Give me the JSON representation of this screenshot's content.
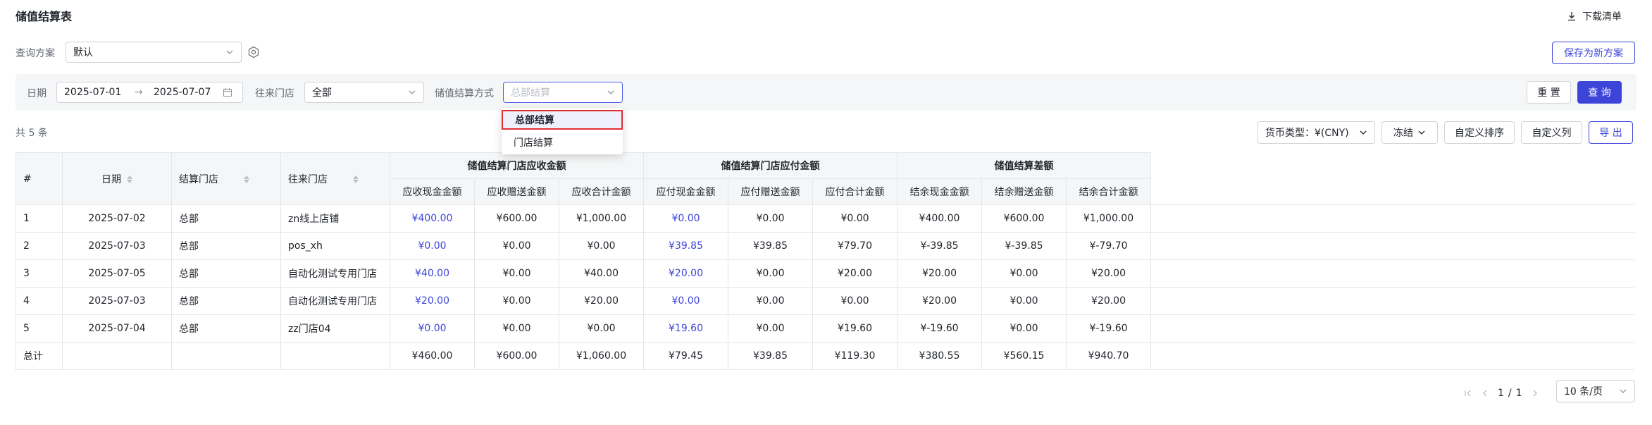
{
  "header": {
    "title": "储值结算表",
    "download_label": "下载清单"
  },
  "plan": {
    "label": "查询方案",
    "value": "默认",
    "save_label": "保存为新方案"
  },
  "filters": {
    "date_label": "日期",
    "date_start": "2025-07-01",
    "date_sep": "→",
    "date_end": "2025-07-07",
    "store_label": "往来门店",
    "store_value": "全部",
    "method_label": "储值结算方式",
    "method_placeholder": "总部结算",
    "reset_label": "重 置",
    "query_label": "查 询"
  },
  "dropdown": {
    "options": [
      "总部结算",
      "门店结算"
    ],
    "selected_index": 0
  },
  "toolbar": {
    "count": "共 5 条",
    "currency_label": "货币类型：¥(CNY)",
    "freeze_label": "冻结",
    "custom_sort_label": "自定义排序",
    "custom_cols_label": "自定义列",
    "export_label": "导 出"
  },
  "table": {
    "fixed_headers": [
      "#",
      "日期",
      "结算门店",
      "往来门店"
    ],
    "groups": [
      {
        "label": "储值结算门店应收金额",
        "cols": [
          "应收现金金额",
          "应收赠送金额",
          "应收合计金额"
        ]
      },
      {
        "label": "储值结算门店应付金额",
        "cols": [
          "应付现金金额",
          "应付赠送金额",
          "应付合计金额"
        ]
      },
      {
        "label": "储值结算差额",
        "cols": [
          "结余现金金额",
          "结余赠送金额",
          "结余合计金额"
        ]
      }
    ],
    "rows": [
      [
        "1",
        "2025-07-02",
        "总部",
        "zn线上店铺",
        "¥400.00",
        "¥600.00",
        "¥1,000.00",
        "¥0.00",
        "¥0.00",
        "¥0.00",
        "¥400.00",
        "¥600.00",
        "¥1,000.00"
      ],
      [
        "2",
        "2025-07-03",
        "总部",
        "pos_xh",
        "¥0.00",
        "¥0.00",
        "¥0.00",
        "¥39.85",
        "¥39.85",
        "¥79.70",
        "¥-39.85",
        "¥-39.85",
        "¥-79.70"
      ],
      [
        "3",
        "2025-07-05",
        "总部",
        "自动化测试专用门店",
        "¥40.00",
        "¥0.00",
        "¥40.00",
        "¥20.00",
        "¥0.00",
        "¥20.00",
        "¥20.00",
        "¥0.00",
        "¥20.00"
      ],
      [
        "4",
        "2025-07-03",
        "总部",
        "自动化测试专用门店",
        "¥20.00",
        "¥0.00",
        "¥20.00",
        "¥0.00",
        "¥0.00",
        "¥0.00",
        "¥20.00",
        "¥0.00",
        "¥20.00"
      ],
      [
        "5",
        "2025-07-04",
        "总部",
        "zz门店04",
        "¥0.00",
        "¥0.00",
        "¥0.00",
        "¥19.60",
        "¥0.00",
        "¥19.60",
        "¥-19.60",
        "¥0.00",
        "¥-19.60"
      ]
    ],
    "totals": [
      "总计",
      "",
      "",
      "",
      "¥460.00",
      "¥600.00",
      "¥1,060.00",
      "¥79.45",
      "¥39.85",
      "¥119.30",
      "¥380.55",
      "¥560.15",
      "¥940.70"
    ]
  },
  "pagination": {
    "current": "1",
    "sep": "/",
    "total": "1",
    "page_size": "10 条/页"
  },
  "colors": {
    "primary": "#3d45d8",
    "selected_outline": "#e03131"
  }
}
